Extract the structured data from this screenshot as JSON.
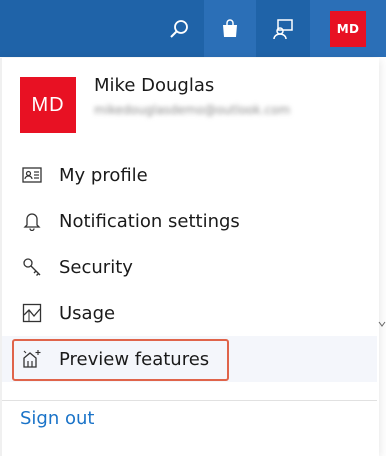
{
  "topbar": {
    "search_icon": "search-icon",
    "store_icon": "shopping-bag-icon",
    "feedback_icon": "feedback-icon",
    "avatar_initials": "MD"
  },
  "profile": {
    "initials": "MD",
    "name": "Mike Douglas",
    "email": "mikedouglasdemo@outlook.com"
  },
  "menu": {
    "items": [
      {
        "label": "My profile",
        "icon": "id-card-icon"
      },
      {
        "label": "Notification settings",
        "icon": "bell-icon"
      },
      {
        "label": "Security",
        "icon": "key-icon"
      },
      {
        "label": "Usage",
        "icon": "usage-chart-icon"
      },
      {
        "label": "Preview features",
        "icon": "preview-sparkle-icon"
      }
    ],
    "sign_out": "Sign out"
  },
  "colors": {
    "topbar": "#1f63a8",
    "avatar": "#e81123",
    "link": "#1a73c8",
    "highlight": "#e0644a"
  }
}
